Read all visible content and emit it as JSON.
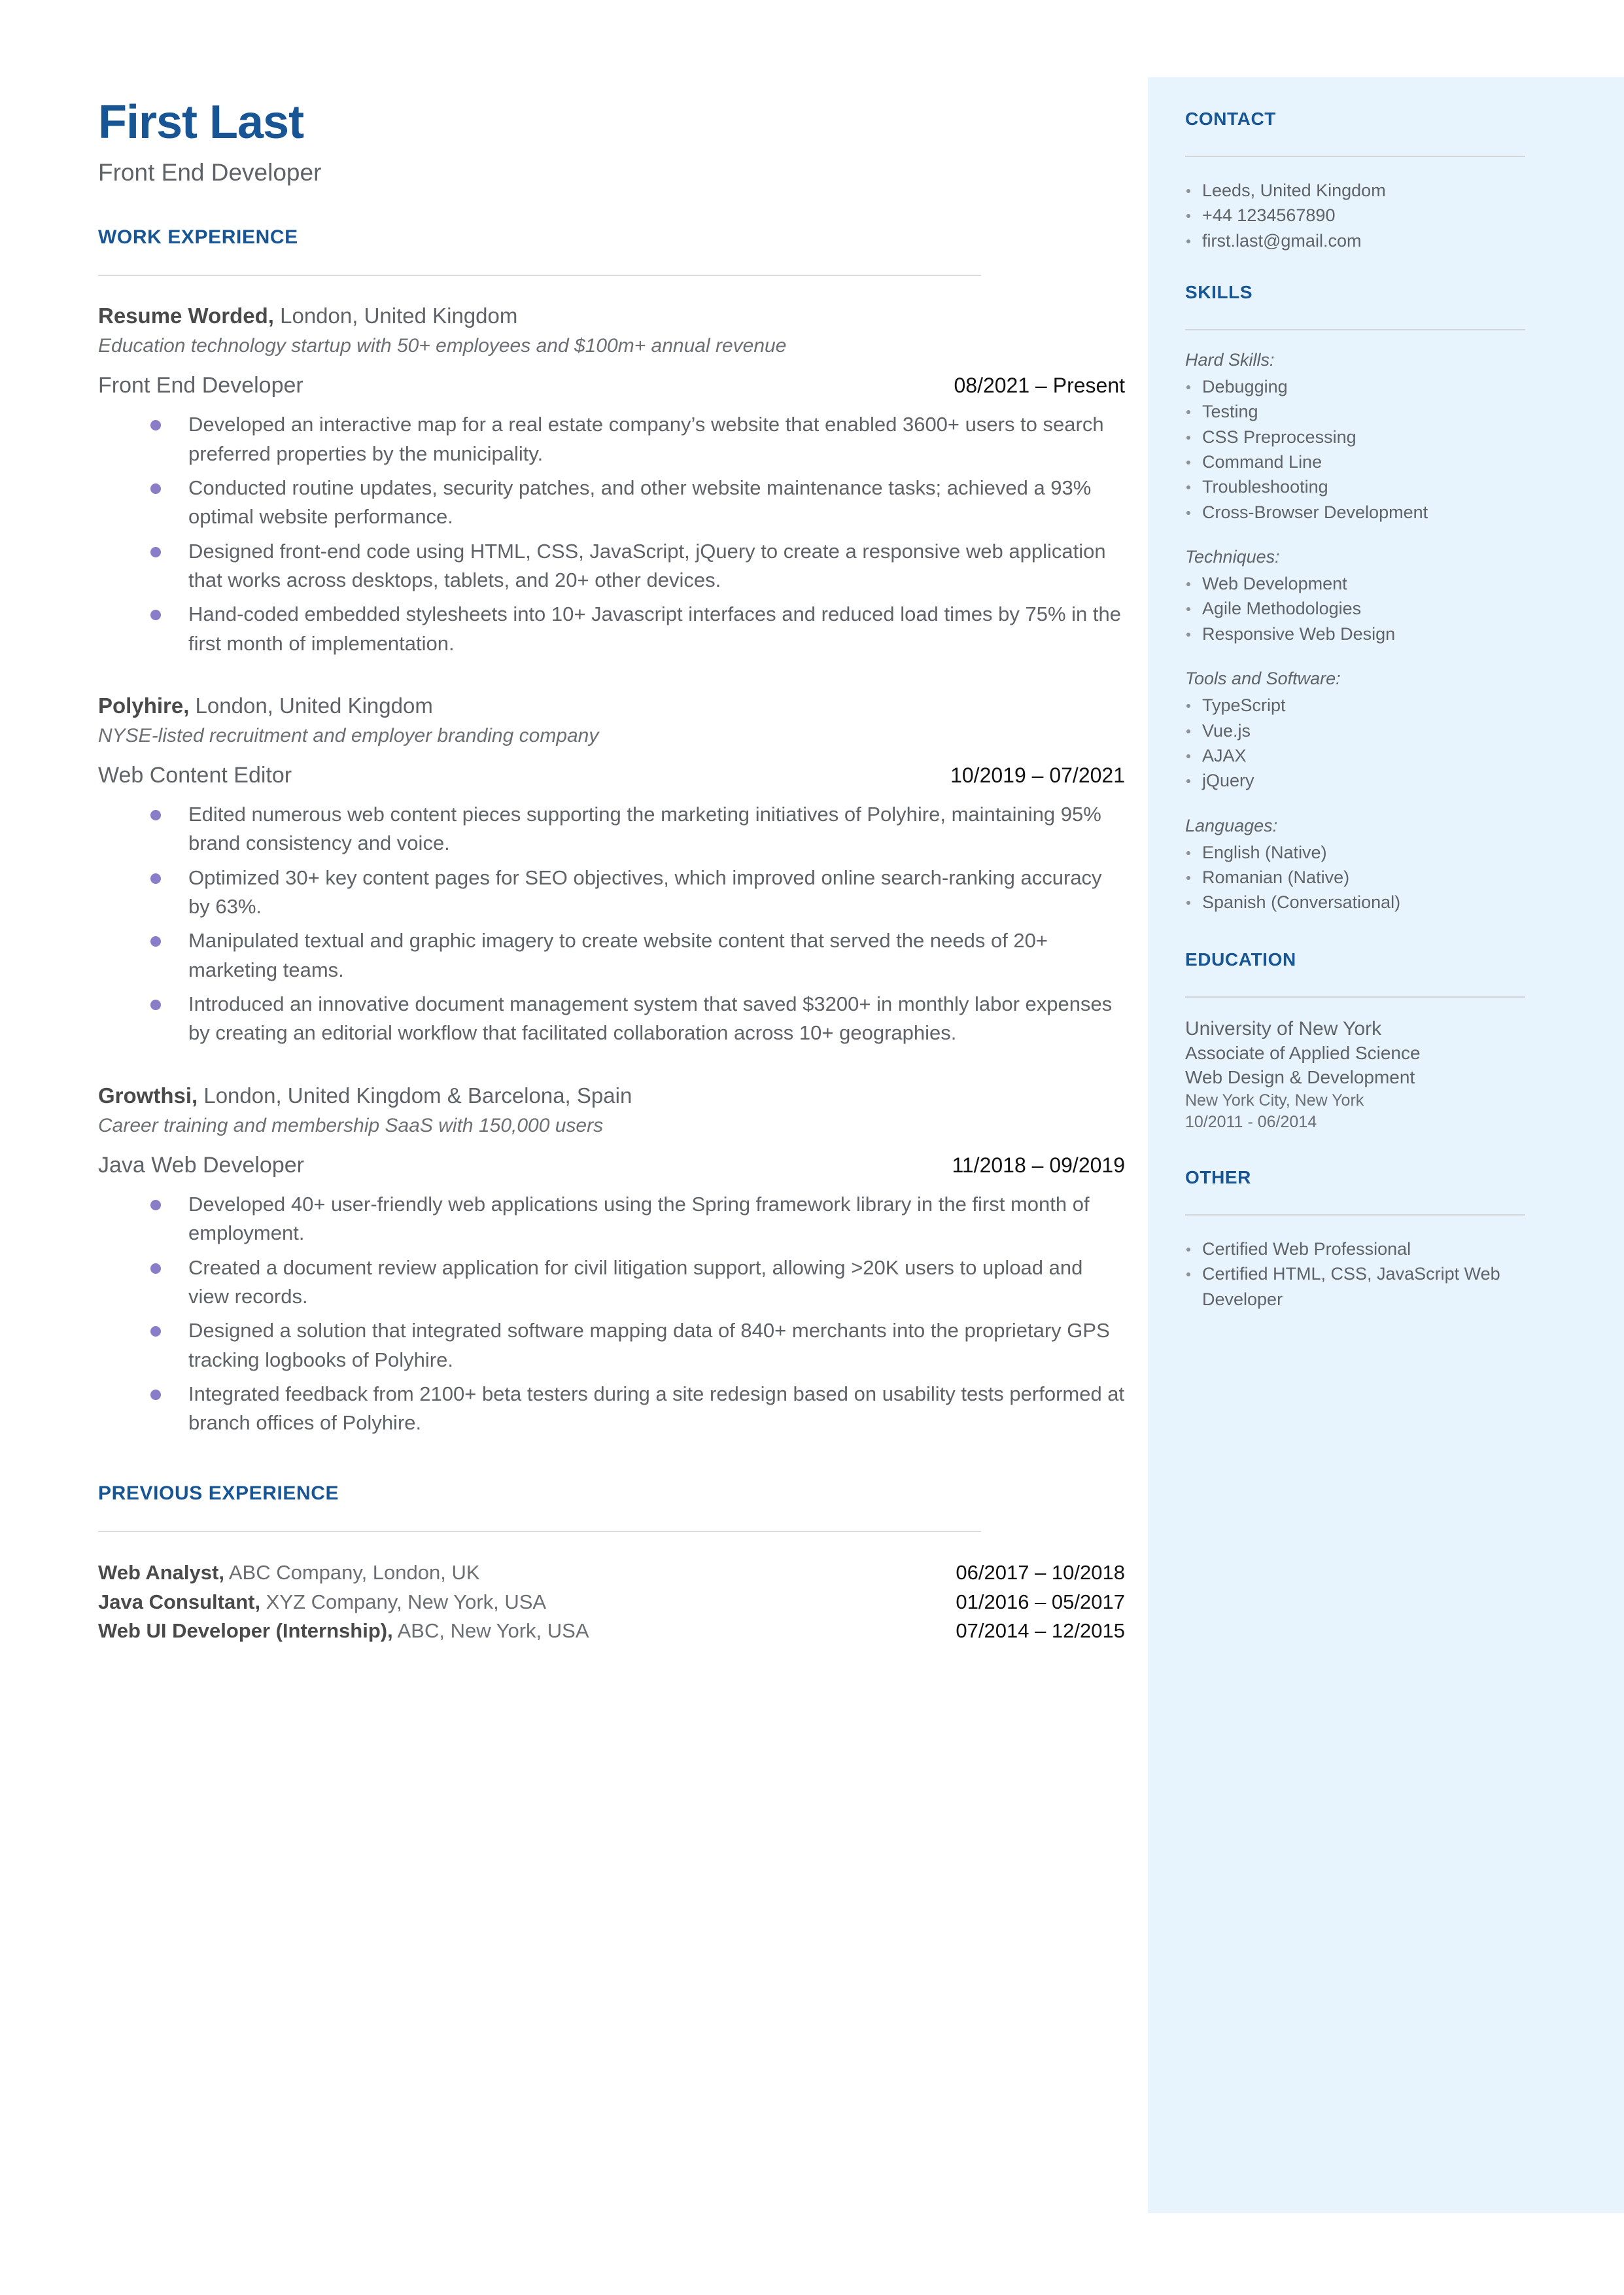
{
  "header": {
    "name": "First Last",
    "title": "Front End Developer"
  },
  "sections": {
    "work_experience": "WORK EXPERIENCE",
    "previous_experience": "PREVIOUS EXPERIENCE",
    "contact": "CONTACT",
    "skills": "SKILLS",
    "education": "EDUCATION",
    "other": "OTHER"
  },
  "colors": {
    "accent_blue": "#175594",
    "sidebar_bg": "#e8f4fd",
    "body_gray": "#5f6368",
    "bullet_purple": "#8b7cc8",
    "rule_gray": "#dcdcdc"
  },
  "jobs": [
    {
      "company": "Resume Worded,",
      "location": " London, United Kingdom",
      "description": "Education technology startup with 50+ employees and $100m+ annual revenue",
      "role": "Front End Developer",
      "dates": "08/2021 – Present",
      "bullets": [
        "Developed an interactive map for a real estate company’s website that enabled 3600+ users to search preferred properties by the municipality.",
        "Conducted routine updates, security patches, and other website maintenance tasks; achieved a 93% optimal website performance.",
        "Designed front-end code using HTML, CSS, JavaScript, jQuery to create a responsive web application that works across desktops, tablets, and 20+ other devices.",
        "Hand-coded embedded stylesheets into 10+ Javascript interfaces and reduced load times by 75% in the first month of implementation."
      ]
    },
    {
      "company": "Polyhire,",
      "location": " London, United Kingdom",
      "description": "NYSE-listed recruitment and employer branding company",
      "role": "Web Content Editor",
      "dates": "10/2019 – 07/2021",
      "bullets": [
        "Edited numerous web content pieces supporting the marketing initiatives of Polyhire, maintaining 95% brand consistency and voice.",
        "Optimized 30+ key content pages for SEO objectives, which improved online search-ranking accuracy by 63%.",
        "Manipulated textual and graphic imagery to create website content that served the needs of 20+ marketing teams.",
        "Introduced an innovative document management system that saved $3200+ in monthly labor expenses by creating an editorial workflow that facilitated collaboration across 10+ geographies."
      ]
    },
    {
      "company": "Growthsi,",
      "location": " London, United Kingdom & Barcelona, Spain",
      "description": "Career training and membership SaaS with 150,000 users",
      "role": "Java Web Developer",
      "dates": "11/2018 – 09/2019",
      "bullets": [
        "Developed 40+ user-friendly web applications using the Spring framework library in the first month of employment.",
        "Created a document review application for civil litigation support, allowing >20K users to upload and view records.",
        "Designed a solution that integrated software mapping data of 840+ merchants into the proprietary GPS tracking logbooks of Polyhire.",
        "Integrated feedback from 2100+ beta testers during a site redesign based on usability tests performed at branch offices of Polyhire."
      ]
    }
  ],
  "previous_jobs": [
    {
      "role": "Web Analyst,",
      "detail": " ABC Company, London, UK",
      "dates": "06/2017 – 10/2018"
    },
    {
      "role": "Java Consultant,",
      "detail": " XYZ Company, New York, USA",
      "dates": "01/2016 – 05/2017"
    },
    {
      "role": "Web UI Developer (Internship),",
      "detail": " ABC, New York, USA",
      "dates": "07/2014 – 12/2015"
    }
  ],
  "contact": {
    "items": [
      "Leeds, United Kingdom",
      "+44 1234567890",
      "first.last@gmail.com"
    ]
  },
  "skills": {
    "groups": [
      {
        "label": "Hard Skills:",
        "items": [
          "Debugging",
          "Testing",
          "CSS Preprocessing",
          "Command Line",
          "Troubleshooting",
          "Cross-Browser Development"
        ]
      },
      {
        "label": "Techniques:",
        "items": [
          "Web Development",
          "Agile Methodologies",
          "Responsive Web Design"
        ]
      },
      {
        "label": "Tools and Software:",
        "items": [
          "TypeScript",
          "Vue.js",
          "AJAX",
          "jQuery"
        ]
      },
      {
        "label": "Languages:",
        "items": [
          "English (Native)",
          "Romanian (Native)",
          "Spanish (Conversational)"
        ]
      }
    ]
  },
  "education": {
    "school": "University of New York",
    "degree": "Associate of Applied Science",
    "field": "Web Design & Development",
    "location": "New York City, New York",
    "dates": "10/2011 - 06/2014"
  },
  "other": {
    "items": [
      "Certified Web Professional",
      "Certified HTML, CSS, JavaScript Web Developer"
    ]
  }
}
